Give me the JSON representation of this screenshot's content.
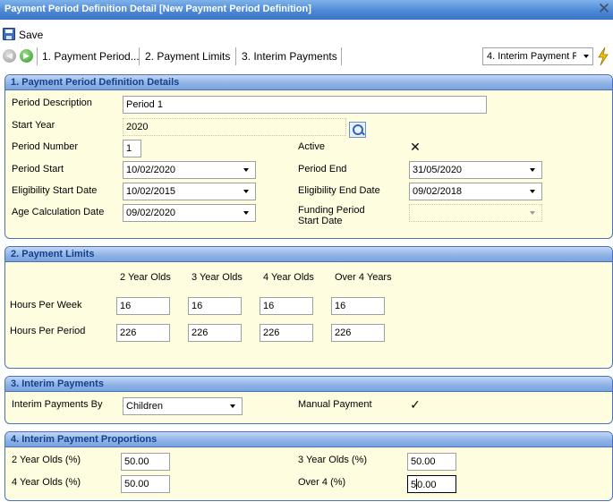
{
  "window": {
    "title": "Payment Period Definition Detail [New Payment Period Definition]"
  },
  "toolbar": {
    "save_label": "Save"
  },
  "nav": {
    "tabs": [
      "1. Payment Period...",
      "2. Payment Limits",
      "3. Interim Payments"
    ],
    "section_select": "4. Interim Payment Pr"
  },
  "section1": {
    "title": "1. Payment Period Definition Details",
    "period_description": {
      "label": "Period Description",
      "value": "Period 1"
    },
    "start_year": {
      "label": "Start Year",
      "value": "2020"
    },
    "period_number": {
      "label": "Period Number",
      "value": "1"
    },
    "active": {
      "label": "Active",
      "checked": true,
      "mark": "✕"
    },
    "period_start": {
      "label": "Period Start",
      "value": "10/02/2020"
    },
    "period_end": {
      "label": "Period End",
      "value": "31/05/2020"
    },
    "eligibility_start": {
      "label": "Eligibility Start Date",
      "value": "10/02/2015"
    },
    "eligibility_end": {
      "label": "Eligibility End Date",
      "value": "09/02/2018"
    },
    "age_calc": {
      "label": "Age Calculation Date",
      "value": "09/02/2020"
    },
    "funding_start": {
      "label_line1": "Funding Period",
      "label_line2": "Start Date",
      "value": ""
    }
  },
  "section2": {
    "title": "2. Payment Limits",
    "columns": [
      "2 Year Olds",
      "3 Year Olds",
      "4 Year Olds",
      "Over 4 Years"
    ],
    "rows": [
      {
        "label": "Hours Per Week",
        "values": [
          "16",
          "16",
          "16",
          "16"
        ]
      },
      {
        "label": "Hours Per Period",
        "values": [
          "226",
          "226",
          "226",
          "226"
        ]
      }
    ]
  },
  "section3": {
    "title": "3. Interim Payments",
    "interim_by": {
      "label": "Interim Payments By",
      "value": "Children"
    },
    "manual": {
      "label": "Manual Payment",
      "checked": true,
      "mark": "✓"
    }
  },
  "section4": {
    "title": "4. Interim Payment Proportions",
    "two_year": {
      "label": "2 Year Olds (%)",
      "value": "50.00"
    },
    "three_year": {
      "label": "3 Year Olds (%)",
      "value": "50.00"
    },
    "four_year": {
      "label": "4 Year Olds (%)",
      "value": "50.00"
    },
    "over_four": {
      "label": "Over 4 (%)",
      "value_pre": "5",
      "value_post": "0.00"
    }
  }
}
